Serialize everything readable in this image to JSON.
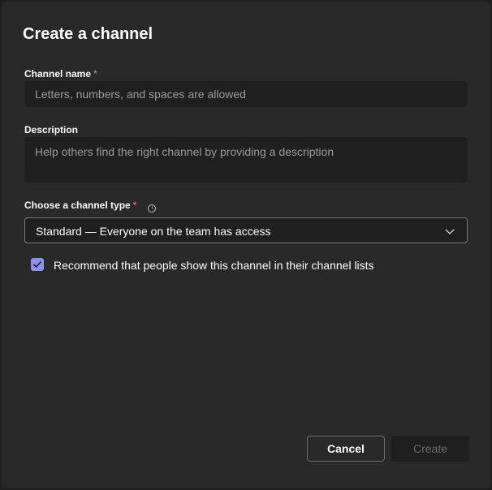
{
  "dialog": {
    "title": "Create a channel"
  },
  "channel_name": {
    "label": "Channel name",
    "required_mark": "*",
    "value": "",
    "placeholder": "Letters, numbers, and spaces are allowed"
  },
  "description": {
    "label": "Description",
    "value": "",
    "placeholder": "Help others find the right channel by providing a description"
  },
  "channel_type": {
    "label": "Choose a channel type",
    "required_mark": "*",
    "info_icon": "info-icon",
    "selected": "Standard — Everyone on the team has access"
  },
  "recommend": {
    "checked": true,
    "label": "Recommend that people show this channel in their channel lists"
  },
  "actions": {
    "cancel_label": "Cancel",
    "create_label": "Create",
    "create_disabled": true
  },
  "colors": {
    "accent": "#8f8ff0",
    "dialog_bg": "#292929",
    "input_bg": "#1f1f1f",
    "required": "#f08a8a"
  }
}
